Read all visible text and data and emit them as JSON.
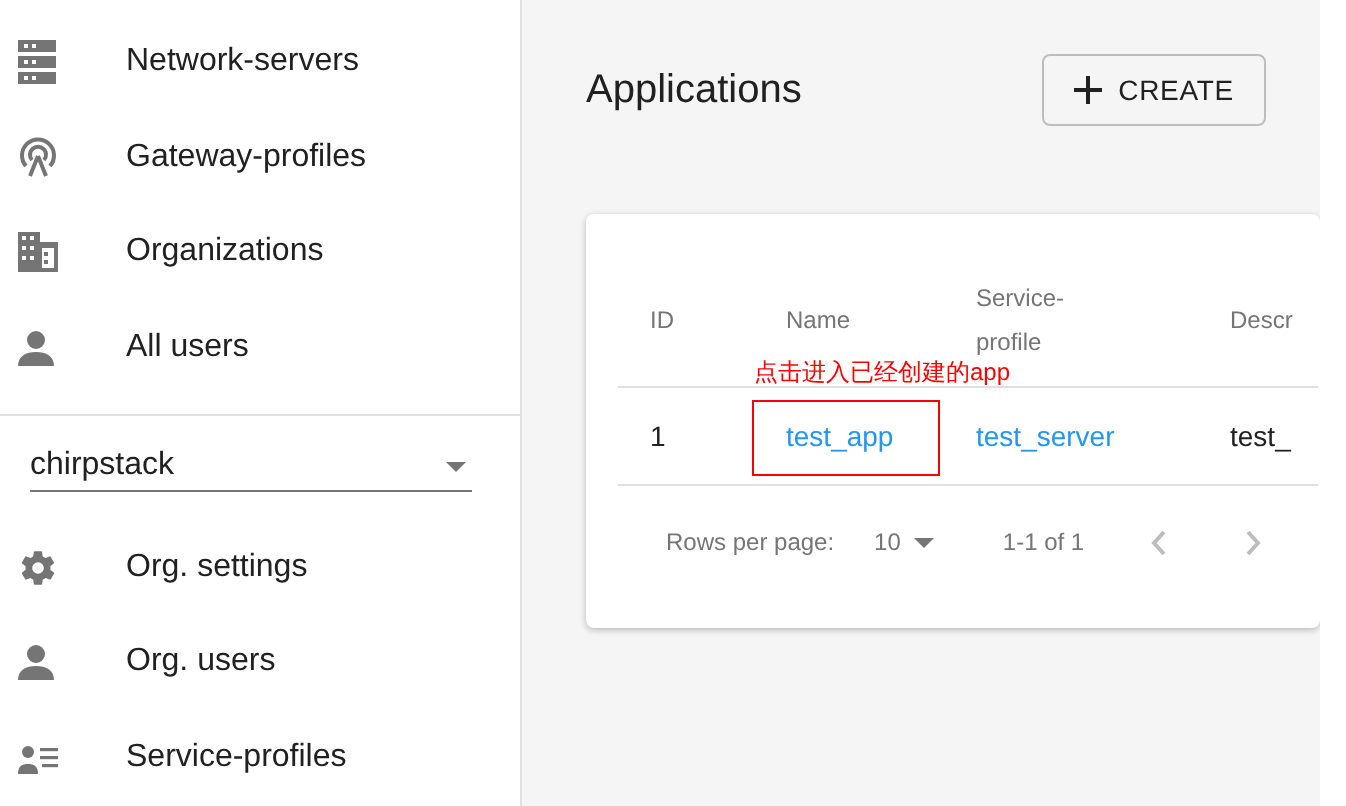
{
  "sidebar": {
    "items": [
      {
        "label": "Network-servers",
        "kind": "servers"
      },
      {
        "label": "Gateway-profiles",
        "kind": "antenna"
      },
      {
        "label": "Organizations",
        "kind": "building"
      },
      {
        "label": "All users",
        "kind": "person"
      }
    ],
    "organization_select": {
      "value": "chirpstack"
    },
    "org_items": [
      {
        "label": "Org. settings",
        "kind": "gear"
      },
      {
        "label": "Org. users",
        "kind": "person"
      },
      {
        "label": "Service-profiles",
        "kind": "person-list"
      }
    ]
  },
  "page": {
    "title": "Applications",
    "create_button": "CREATE"
  },
  "table": {
    "columns": [
      "ID",
      "Name",
      "Service-profile",
      "Descr"
    ],
    "rows": [
      {
        "id": "1",
        "name": "test_app",
        "service_profile": "test_server",
        "column_4": "test_"
      }
    ],
    "pagination": {
      "rows_per_page_label": "Rows per page:",
      "rows_per_page": "10",
      "range": "1-1 of 1"
    }
  },
  "annotation": {
    "text": "点击进入已经创建的app"
  }
}
